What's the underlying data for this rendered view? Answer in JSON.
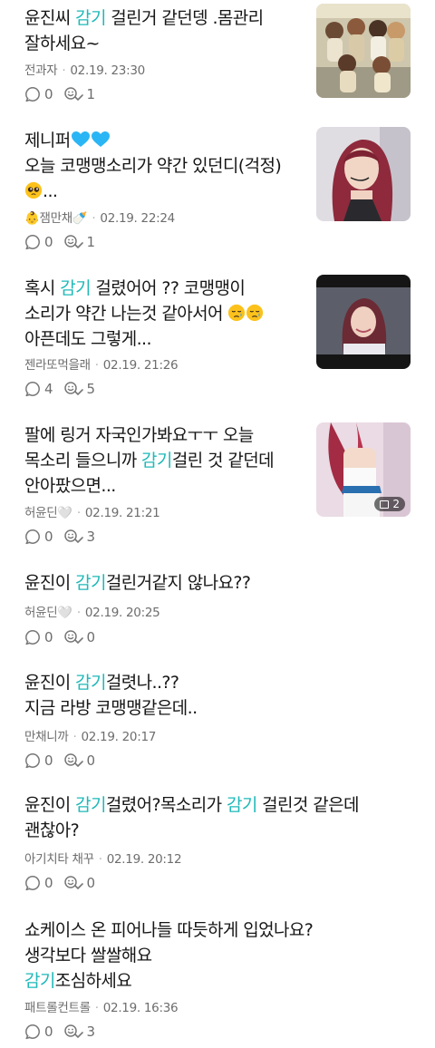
{
  "posts": [
    {
      "lines": [
        [
          {
            "t": "윤진씨 "
          },
          {
            "t": "감기",
            "hl": true
          },
          {
            "t": " 걸린거 같던뎅 .몸관리"
          }
        ],
        [
          {
            "t": "잘하세요~"
          }
        ]
      ],
      "author": "전과자",
      "time": "02.19. 23:30",
      "comments": "0",
      "likes": "1",
      "has_thumb": true,
      "thumb_kind": "group"
    },
    {
      "lines": [
        [
          {
            "t": "제니퍼"
          },
          {
            "icon": "heart"
          },
          {
            "icon": "heart"
          }
        ],
        [
          {
            "t": "오늘 코맹맹소리가 약간 있던디(걱정)"
          }
        ],
        [
          {
            "icon": "pleading-emoji"
          },
          {
            "t": "..."
          }
        ]
      ],
      "author_prefix": "👶",
      "author": "잼만채",
      "author_suffix": "🍼",
      "time": "02.19. 22:24",
      "comments": "0",
      "likes": "1",
      "has_thumb": true,
      "thumb_kind": "portrait"
    },
    {
      "lines": [
        [
          {
            "t": "혹시 "
          },
          {
            "t": "감기",
            "hl": true
          },
          {
            "t": " 걸렸어어 ?? 코맹맹이"
          }
        ],
        [
          {
            "t": "소리가 약간 나는것 같아서어 "
          },
          {
            "icon": "crying-emoji"
          },
          {
            "icon": "crying-emoji"
          }
        ],
        [
          {
            "t": "아픈데도 그렇게..."
          }
        ]
      ],
      "author": "젠라또먹을래",
      "time": "02.19. 21:26",
      "comments": "4",
      "likes": "5",
      "has_thumb": true,
      "thumb_kind": "stage"
    },
    {
      "lines": [
        [
          {
            "t": "팔에 링거 자국인가봐요ㅜㅜ 오늘"
          }
        ],
        [
          {
            "t": "목소리 들으니까 "
          },
          {
            "t": "감기",
            "hl": true
          },
          {
            "t": "걸린 것 같던데"
          }
        ],
        [
          {
            "t": "안아팠으면..."
          }
        ]
      ],
      "author": "허윤딘",
      "author_suffix": "🤍",
      "time": "02.19. 21:21",
      "comments": "0",
      "likes": "3",
      "has_thumb": true,
      "thumb_kind": "fashion",
      "thumb_count": "2"
    },
    {
      "lines": [
        [
          {
            "t": "윤진이 "
          },
          {
            "t": "감기",
            "hl": true
          },
          {
            "t": "걸린거같지 않나요??"
          }
        ]
      ],
      "author": "허윤딘",
      "author_suffix": "🤍",
      "time": "02.19. 20:25",
      "comments": "0",
      "likes": "0",
      "has_thumb": false
    },
    {
      "lines": [
        [
          {
            "t": "윤진이 "
          },
          {
            "t": "감기",
            "hl": true
          },
          {
            "t": "걸렷나..??"
          }
        ],
        [
          {
            "t": "지금 라방 코맹맹같은데.."
          }
        ]
      ],
      "author": "만채니까",
      "time": "02.19. 20:17",
      "comments": "0",
      "likes": "0",
      "has_thumb": false
    },
    {
      "lines": [
        [
          {
            "t": "윤진이 "
          },
          {
            "t": "감기",
            "hl": true
          },
          {
            "t": "걸렸어?목소리가 "
          },
          {
            "t": "감기",
            "hl": true
          },
          {
            "t": " 걸린것 같은데"
          }
        ],
        [
          {
            "t": "괜찮아?"
          }
        ]
      ],
      "author": "아기치타 채꾸",
      "time": "02.19. 20:12",
      "comments": "0",
      "likes": "0",
      "has_thumb": false
    },
    {
      "lines": [
        [
          {
            "t": "쇼케이스 온 피어나들 따듯하게 입었나요?"
          }
        ],
        [
          {
            "t": "생각보다 쌀쌀해요"
          }
        ],
        [
          {
            "t": "감기",
            "hl": true
          },
          {
            "t": "조심하세요"
          }
        ]
      ],
      "author": "패트롤컨트롤",
      "time": "02.19. 16:36",
      "comments": "0",
      "likes": "3",
      "has_thumb": false
    }
  ],
  "colors": {
    "highlight": "#1fb8b8",
    "heart": "#29b6f6",
    "meta": "#6d6d6d"
  },
  "icons": {
    "comment": "speech-bubble-icon",
    "like": "sympathy-icon"
  }
}
